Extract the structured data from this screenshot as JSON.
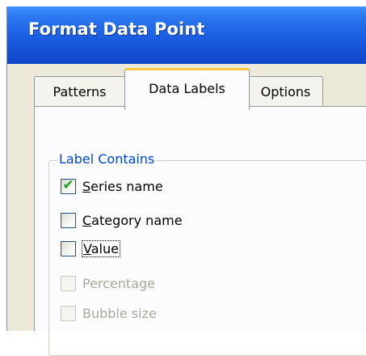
{
  "dialog": {
    "title": "Format Data Point"
  },
  "tabs": [
    {
      "label": "Patterns",
      "active": false
    },
    {
      "label": "Data Labels",
      "active": true
    },
    {
      "label": "Options",
      "active": false
    }
  ],
  "label_contains": {
    "heading": "Label Contains",
    "options": [
      {
        "mnemonic": "S",
        "rest": "eries name",
        "checked": true,
        "enabled": true
      },
      {
        "mnemonic": "C",
        "rest": "ategory name",
        "checked": false,
        "enabled": true
      },
      {
        "mnemonic": "V",
        "rest": "alue",
        "checked": false,
        "enabled": true,
        "focused": true
      },
      {
        "label": "Percentage",
        "checked": false,
        "enabled": false
      },
      {
        "label": "Bubble size",
        "checked": false,
        "enabled": false
      }
    ]
  },
  "colors": {
    "title_bar": "#1f63e6",
    "active_tab_accent": "#ffc83c",
    "group_label": "#0046d5",
    "checkmark": "#21a121"
  }
}
